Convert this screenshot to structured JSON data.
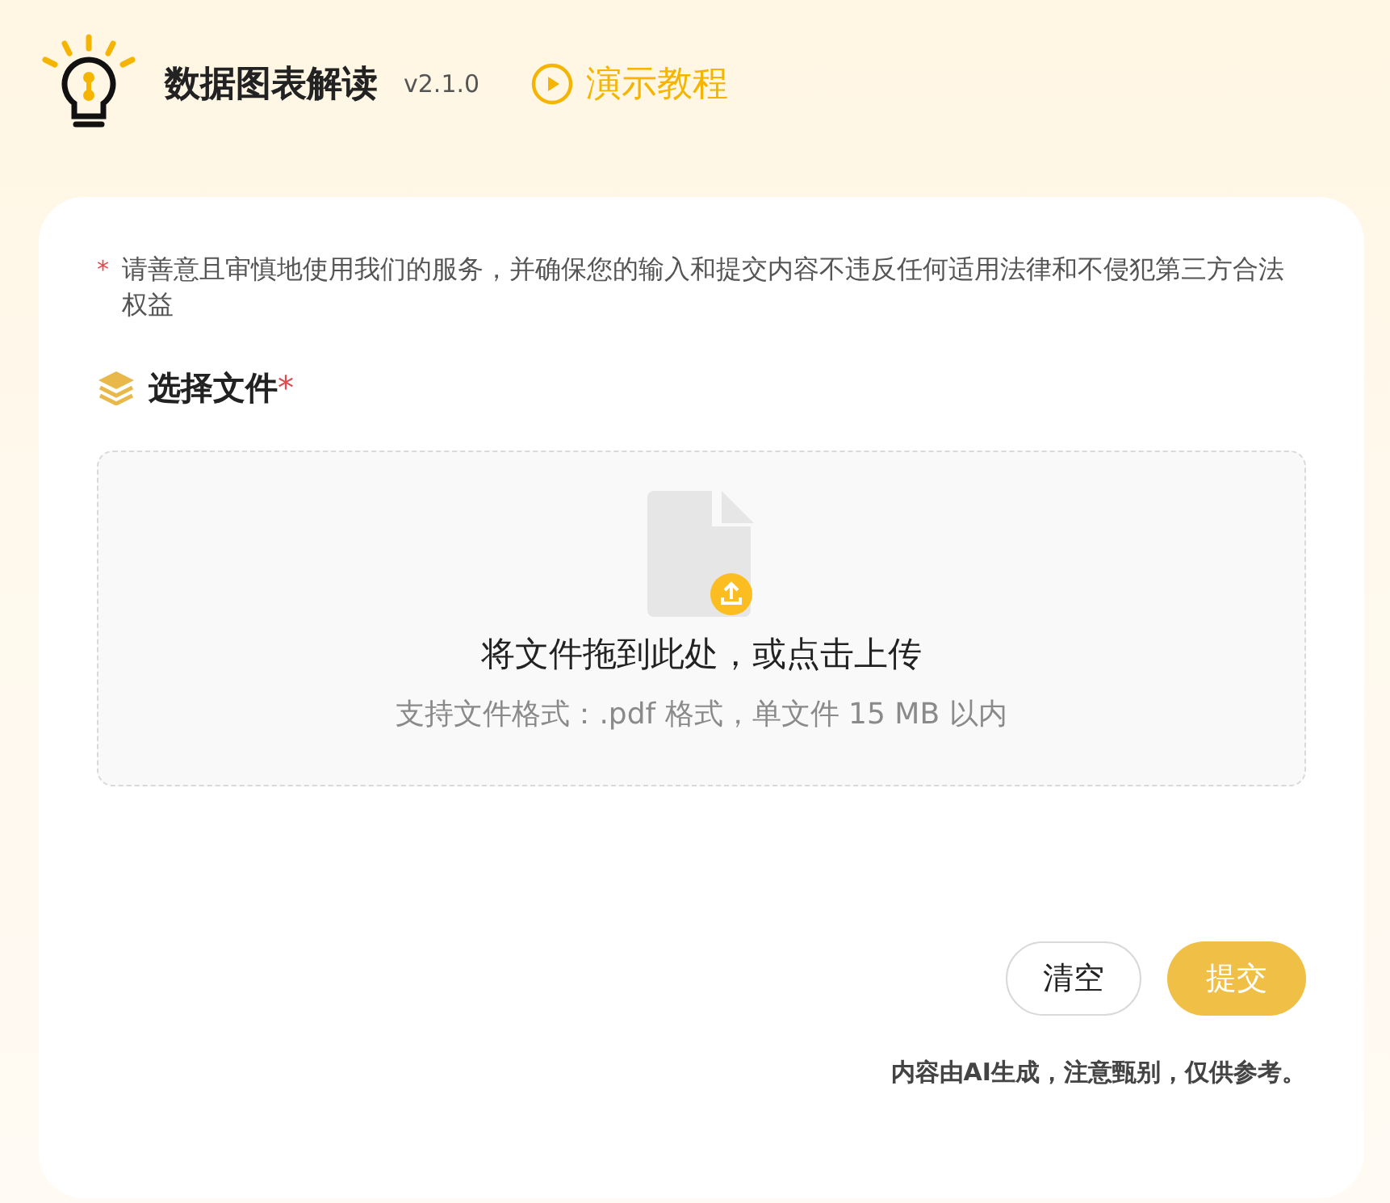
{
  "header": {
    "title": "数据图表解读",
    "version": "v2.1.0",
    "tutorial_link": "演示教程"
  },
  "notice": {
    "mark": "*",
    "text": "请善意且审慎地使用我们的服务，并确保您的输入和提交内容不违反任何适用法律和不侵犯第三方合法权益"
  },
  "file_section": {
    "label": "选择文件",
    "required_mark": "*"
  },
  "upload": {
    "title": "将文件拖到此处，或点击上传",
    "hint": "支持文件格式：.pdf 格式，单文件 15 MB 以内"
  },
  "buttons": [
    {
      "label": "清空",
      "kind": "secondary"
    },
    {
      "label": "提交",
      "kind": "primary"
    }
  ],
  "footer_note": "内容由AI生成，注意甄别，仅供参考。"
}
